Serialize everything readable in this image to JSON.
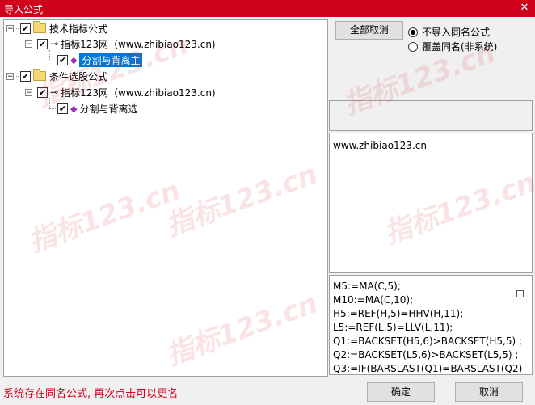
{
  "window": {
    "title": "导入公式",
    "close_glyph": "✕"
  },
  "tree": {
    "nodes": [
      {
        "label": "技术指标公式",
        "expander": "−",
        "checked": true
      },
      {
        "label": "指标123网（www.zhibiao123.cn)",
        "expander": "−",
        "checked": true
      },
      {
        "label": "分割与背离主",
        "checked": true,
        "selected": true
      },
      {
        "label": "条件选股公式",
        "expander": "−",
        "checked": true
      },
      {
        "label": "指标123网（www.zhibiao123.cn)",
        "expander": "−",
        "checked": true
      },
      {
        "label": "分割与背离选",
        "checked": true
      }
    ],
    "check_glyph": "✔"
  },
  "controls": {
    "cancel_all_label": "全部取消",
    "radio_options": [
      {
        "label": "不导入同名公式",
        "selected": true
      },
      {
        "label": "覆盖同名(非系统)",
        "selected": false
      }
    ]
  },
  "description": {
    "text": "www.zhibiao123.cn"
  },
  "code": {
    "lines": [
      "M5:=MA(C,5);",
      "M10:=MA(C,10);",
      "H5:=REF(H,5)=HHV(H,11);",
      "L5:=REF(L,5)=LLV(L,11);",
      "Q1:=BACKSET(H5,6)>BACKSET(H5,5) ;",
      "Q2:=BACKSET(L5,6)>BACKSET(L5,5) ;",
      "Q3:=IF(BARSLAST(Q1)=BARSLAST(Q2)"
    ]
  },
  "footer": {
    "status_text": "系统存在同名公式, 再次点击可以更名",
    "ok_label": "确定",
    "cancel_label": "取消"
  },
  "watermark": {
    "text": "指标123.cn"
  },
  "colors": {
    "titlebar": "#d0021b",
    "status_text": "#d0021b",
    "selection": "#0078d7"
  }
}
